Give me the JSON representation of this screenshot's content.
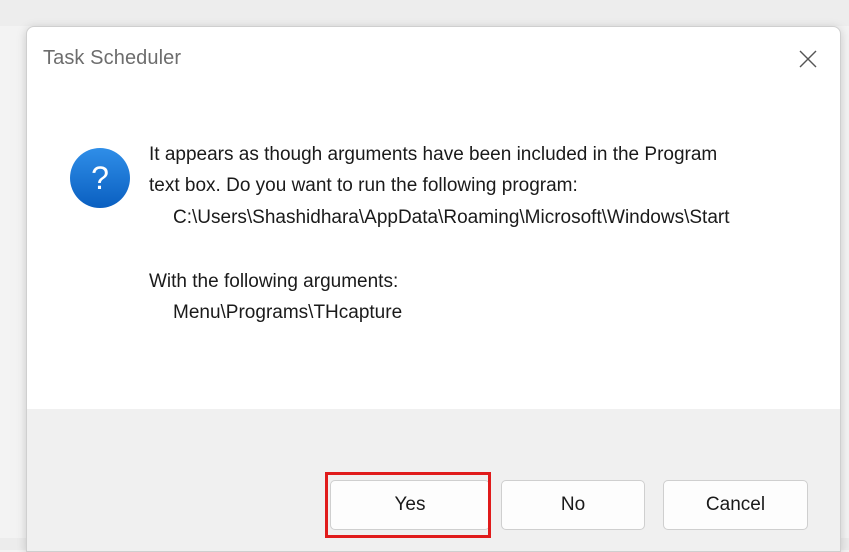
{
  "dialog": {
    "title": "Task Scheduler",
    "close_icon": "close-icon",
    "question_icon": "question-icon",
    "message": {
      "line1": "It appears as though arguments have been included in the Program",
      "line2": "text box. Do you want to run the following program:",
      "program_path": "C:\\Users\\Shashidhara\\AppData\\Roaming\\Microsoft\\Windows\\Start",
      "args_label": "With the following arguments:",
      "arguments": "Menu\\Programs\\THcapture"
    },
    "buttons": {
      "yes": "Yes",
      "no": "No",
      "cancel": "Cancel"
    }
  },
  "colors": {
    "icon_blue": "#0a67c9",
    "highlight_red": "#e01b1b",
    "footer_bg": "#f0f0f0"
  }
}
